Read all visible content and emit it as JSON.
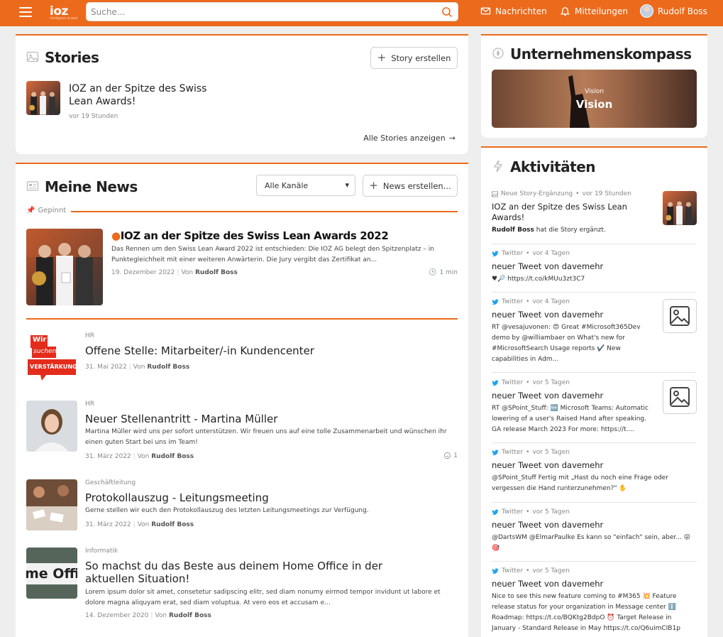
{
  "topbar": {
    "logo": "ioz",
    "logo_sub": "intelligence at work",
    "search_placeholder": "Suche...",
    "messages_label": "Nachrichten",
    "notifications_label": "Mitteilungen",
    "user_name": "Rudolf Boss"
  },
  "stories": {
    "title": "Stories",
    "create_label": "Story erstellen",
    "item_title": "IOZ an der Spitze des Swiss Lean Awards!",
    "item_time": "vor 19 Stunden",
    "show_all": "Alle Stories anzeigen"
  },
  "news": {
    "title": "Meine News",
    "channel_select": "Alle Kanäle",
    "create_label": "News erstellen...",
    "pinned_label": "Gepinnt",
    "pinned": {
      "title": "IOZ an der Spitze des Swiss Lean Awards 2022",
      "text": "Das Rennen um den Swiss Lean Award 2022 ist entschieden: Die IOZ AG belegt den Spitzenplatz – in Punktegleichheit mit einer weiteren Anwärterin. Die Jury vergibt das Zertifikat an...",
      "date": "19. Dezember 2022",
      "von": "Von",
      "author": "Rudolf Boss",
      "read_time": "1 min"
    },
    "items": [
      {
        "category": "HR",
        "title": "Offene Stelle: Mitarbeiter/-in Kundencenter",
        "text": "",
        "date": "31. Mai 2022",
        "von": "Von",
        "author": "Rudolf Boss",
        "thumb_text_1": "Wir",
        "thumb_text_2": "suchen",
        "thumb_text_3": "VERSTÄRKUNG"
      },
      {
        "category": "HR",
        "title": "Neuer Stellenantritt - Martina Müller",
        "text": "Martina Müller wird uns per sofort unterstützen. Wir freuen uns auf eine tolle Zusammenarbeit und wünschen ihr einen guten Start bei uns im Team!",
        "date": "31. März 2022",
        "von": "Von",
        "author": "Rudolf Boss",
        "comments": "1"
      },
      {
        "category": "Geschäftleitung",
        "title": "Protokollauszug - Leitungsmeeting",
        "text": "Gerne stellen wir euch den Protokollauszug des letzten Leitungsmeetings zur Verfügung.",
        "date": "31. März 2022",
        "von": "Von",
        "author": "Rudolf Boss"
      },
      {
        "category": "Informatik",
        "title": "So machst du das Beste aus deinem Home Office in der aktuellen Situation!",
        "text": "Lorem ipsum dolor sit amet, consetetur sadipscing elitr, sed diam nonumy eirmod tempor invidunt ut labore et dolore magna aliquyam erat, sed diam voluptua. At vero eos et accusam e...",
        "date": "14. Dezember 2020",
        "von": "Von",
        "author": "Rudolf Boss",
        "thumb_text": "me Offi"
      }
    ]
  },
  "compass": {
    "title": "Unternehmenskompass",
    "banner_small": "Vision",
    "banner_big": "Vision"
  },
  "activities": {
    "title": "Aktivitäten",
    "items": [
      {
        "source": "Neue Story-Ergänzung",
        "time": "vor 19 Stunden",
        "title": "IOZ an der Spitze des Swiss Lean Awards!",
        "author": "Rudolf Boss",
        "body": "hat die Story ergänzt."
      },
      {
        "source": "Twitter",
        "time": "vor 4 Tagen",
        "title": "neuer Tweet von davemehr",
        "body": "♥🔎 https://t.co/kMUu3zt3C7"
      },
      {
        "source": "Twitter",
        "time": "vor 4 Tagen",
        "title": "neuer Tweet von davemehr",
        "body": "RT @vesajuvonen: 😍 Great #Microsoft365Dev demo by @williambaer on What's new for #MicrosoftSearch Usage reports ✔️ New capabilities in Adm..."
      },
      {
        "source": "Twitter",
        "time": "vor 5 Tagen",
        "title": "neuer Tweet von davemehr",
        "body": "RT @SPoint_Stuff: 🆕 Microsoft Teams: Automatic lowering of a user's Raised Hand after speaking. GA release March 2023 For more: https://t...."
      },
      {
        "source": "Twitter",
        "time": "vor 5 Tagen",
        "title": "neuer Tweet von davemehr",
        "body": "@SPoint_Stuff Fertig mit „Hast du noch eine Frage oder vergessen die Hand runterzunehmen?\" ✋"
      },
      {
        "source": "Twitter",
        "time": "vor 5 Tagen",
        "title": "neuer Tweet von davemehr",
        "body": "@DartsWM @ElmarPaulke Es kann so \"einfach\" sein, aber... 😜 🎯"
      },
      {
        "source": "Twitter",
        "time": "vor 5 Tagen",
        "title": "neuer Tweet von davemehr",
        "body": "Nice to see this new feature coming to #M365 💥 Feature release status for your organization in Message center ℹ️ Roadmap: https://t.co/BQKtg2BdpO ⏰ Target Release in January - Standard Release in May https://t.co/Q6uimCIB1p"
      }
    ]
  },
  "colors": {
    "accent": "#ec6a1b",
    "background": "#eeeeee",
    "card": "#ffffff",
    "twitter": "#1da1f2"
  }
}
